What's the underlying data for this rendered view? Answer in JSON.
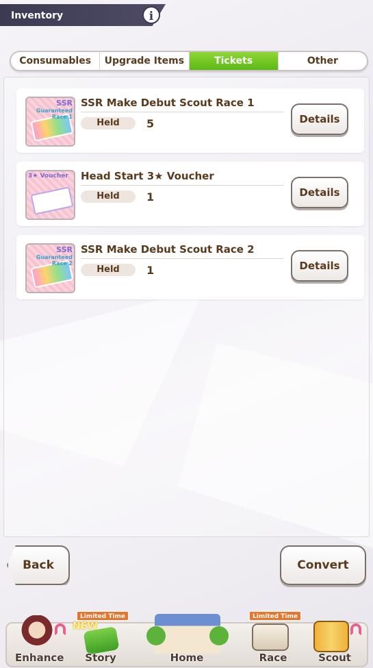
{
  "header": {
    "title": "Inventory",
    "info_icon": "info-icon"
  },
  "tabs": [
    {
      "label": "Consumables",
      "active": false
    },
    {
      "label": "Upgrade Items",
      "active": false
    },
    {
      "label": "Tickets",
      "active": true
    },
    {
      "label": "Other",
      "active": false
    }
  ],
  "items": [
    {
      "name": "SSR Make Debut Scout Race 1",
      "held_label": "Held",
      "count": "5",
      "details_label": "Details",
      "thumb_top": "SSR",
      "thumb_sub": "Guaranteed Race 1"
    },
    {
      "name": "Head Start 3★ Voucher",
      "held_label": "Held",
      "count": "1",
      "details_label": "Details",
      "thumb_top": "3★ Voucher",
      "thumb_sub": ""
    },
    {
      "name": "SSR Make Debut Scout Race 2",
      "held_label": "Held",
      "count": "1",
      "details_label": "Details",
      "thumb_top": "SSR",
      "thumb_sub": "Guaranteed Race 2"
    }
  ],
  "actions": {
    "back_label": "Back",
    "convert_label": "Convert"
  },
  "nav": {
    "enhance": "Enhance",
    "story": "Story",
    "home": "Home",
    "race": "Race",
    "scout": "Scout",
    "limited_time": "Limited Time",
    "new_badge": "NEW"
  },
  "colors": {
    "active_tab": "#5cb815",
    "text": "#5a3a1c",
    "header": "#3c3a52"
  }
}
